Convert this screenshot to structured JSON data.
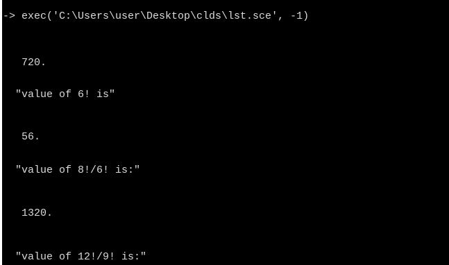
{
  "console": {
    "lines": [
      "-> exec('C:\\Users\\user\\Desktop\\clds\\lst.sce', -1)",
      "   720.",
      "  \"value of 6! is\"",
      "   56.",
      "  \"value of 8!/6! is:\"",
      "   1320.",
      "  \"value of 12!/9! is:\""
    ]
  },
  "colors": {
    "background": "#000000",
    "text": "#d9d9d9",
    "frame": "#ffffff"
  }
}
